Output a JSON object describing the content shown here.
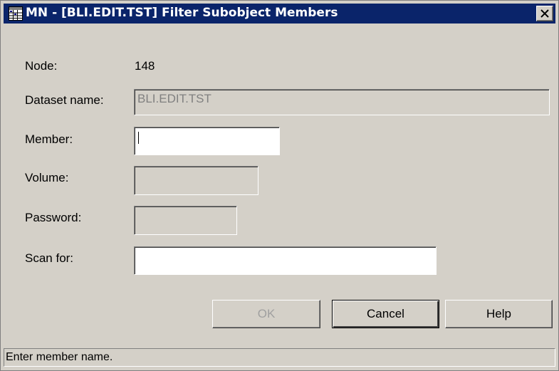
{
  "window": {
    "title": "MN - [BLI.EDIT.TST] Filter Subobject Members",
    "app_icon": "grid-app-icon",
    "close_icon": "close-x-icon"
  },
  "form": {
    "node_label": "Node:",
    "node_value": "148",
    "dataset_label": "Dataset name:",
    "dataset_value": "BLI.EDIT.TST",
    "member_label": "Member:",
    "member_value": "",
    "volume_label": "Volume:",
    "volume_value": "",
    "password_label": "Password:",
    "password_value": "",
    "scan_label": "Scan for:",
    "scan_value": ""
  },
  "buttons": {
    "ok": "OK",
    "cancel": "Cancel",
    "help": "Help"
  },
  "status": {
    "text": "Enter member name."
  },
  "colors": {
    "titlebar": "#0a246a",
    "dialog_face": "#d4d0c8",
    "disabled_text": "#808080"
  }
}
